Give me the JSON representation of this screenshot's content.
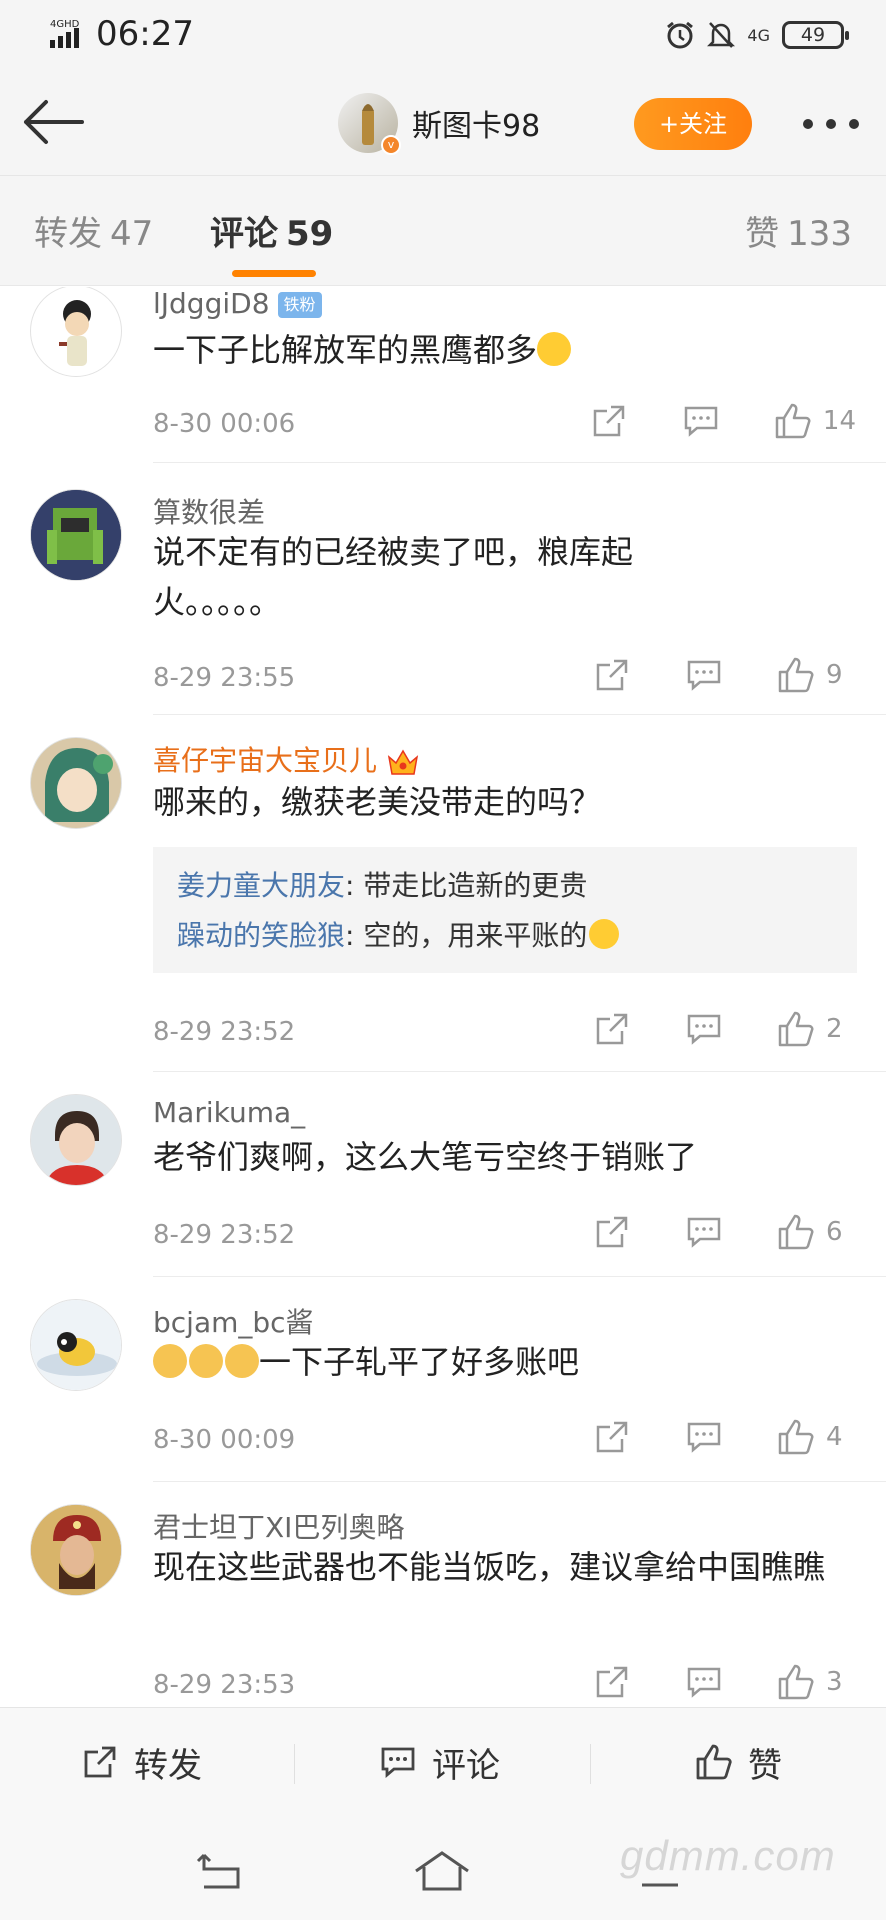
{
  "status_bar": {
    "network_label": "4GHD",
    "time": "06:27",
    "signal_label": "4G",
    "battery": "49"
  },
  "header": {
    "author_name": "斯图卡98",
    "follow_label": "+关注"
  },
  "tabs": {
    "repost": {
      "label": "转发",
      "count": "47"
    },
    "comment": {
      "label": "评论",
      "count": "59"
    },
    "like": {
      "label": "赞",
      "count": "133"
    }
  },
  "comments": [
    {
      "name": "lJdggiD8",
      "badge": "铁粉",
      "text": "一下子比解放军的黑鹰都多",
      "time": "8-30 00:06",
      "likes": "14"
    },
    {
      "name": "算数很差",
      "text": "说不定有的已经被卖了吧，粮库起火。。。。。",
      "time": "8-29 23:55",
      "likes": "9"
    },
    {
      "name": "喜仔宇宙大宝贝儿",
      "text": "哪来的，缴获老美没带走的吗？",
      "replies": [
        {
          "who": "姜力童大朋友",
          "text": ": 带走比造新的更贵"
        },
        {
          "who": "躁动的笑脸狼",
          "text": ": 空的，用来平账的"
        }
      ],
      "time": "8-29 23:52",
      "likes": "2"
    },
    {
      "name": "Marikuma_",
      "text": "老爷们爽啊，这么大笔亏空终于销账了",
      "time": "8-29 23:52",
      "likes": "6"
    },
    {
      "name": "bcjam_bc酱",
      "text": "一下子轧平了好多账吧",
      "time": "8-30 00:09",
      "likes": "4"
    },
    {
      "name": "君士坦丁XI巴列奥略",
      "text": "现在这些武器也不能当饭吃，建议拿给中国瞧瞧",
      "time": "8-29 23:53",
      "likes": "3"
    }
  ],
  "bottom_bar": {
    "repost_label": "转发",
    "comment_label": "评论",
    "like_label": "赞"
  },
  "watermark": "gdmm.com",
  "colors": {
    "accent_orange": "#ff8200",
    "link_blue": "#4a76ac",
    "gold_name": "#e86f1a"
  }
}
